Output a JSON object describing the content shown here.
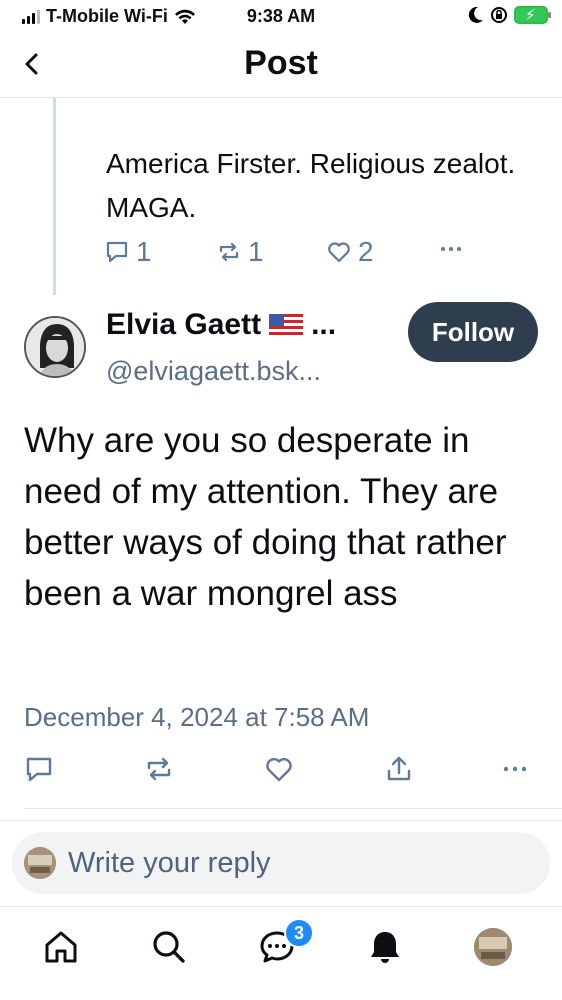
{
  "status_bar": {
    "carrier": "T-Mobile Wi-Fi",
    "time": "9:38 AM"
  },
  "header": {
    "title": "Post"
  },
  "parent_post": {
    "text": "America Firster.  Religious zealot.  MAGA.",
    "reply_count": "1",
    "repost_count": "1",
    "like_count": "2"
  },
  "post": {
    "author_name": "Elvia Gaett",
    "name_ellipsis": "...",
    "handle": "@elviagaett.bsk...",
    "follow_label": "Follow",
    "body": "Why are you so desperate in need of my attention. They are better ways of doing that rather been a war mongrel ass",
    "timestamp": "December 4, 2024 at 7:58 AM"
  },
  "reply": {
    "placeholder": "Write your reply"
  },
  "tabbar": {
    "notification_badge": "3"
  },
  "colors": {
    "accent": "#1d8cf8",
    "follow_bg": "#2e3e4f",
    "muted": "#5f7a98"
  }
}
